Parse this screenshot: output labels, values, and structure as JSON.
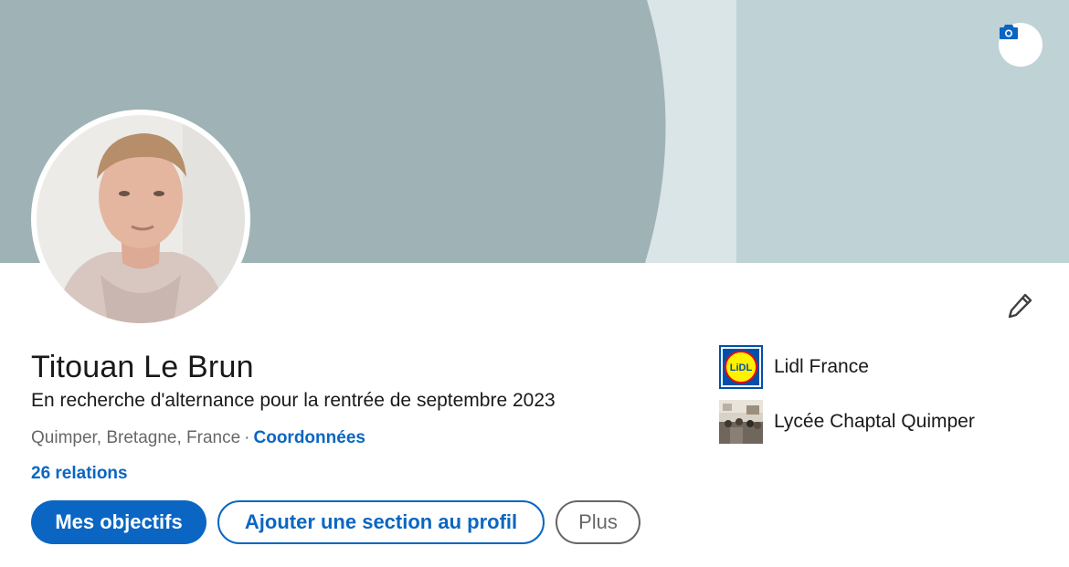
{
  "profile": {
    "name": "Titouan Le Brun",
    "headline": "En recherche d'alternance pour la rentrée de septembre 2023",
    "location": "Quimper, Bretagne, France",
    "separator": "·",
    "contact_link": "Coordonnées",
    "connections": "26 relations"
  },
  "actions": {
    "primary": "Mes objectifs",
    "add_section": "Ajouter une section au profil",
    "more": "Plus"
  },
  "experience_summary": [
    {
      "label": "Lidl France",
      "logo_text": "LiDL",
      "icon": "lidl-logo"
    },
    {
      "label": "Lycée Chaptal Quimper",
      "icon": "school-photo"
    }
  ],
  "colors": {
    "accent": "#0a66c2",
    "cover_dark": "#9fb3b6",
    "cover_light": "#bfd3d7",
    "cover_stripe": "#d9e5e7"
  },
  "icons": {
    "cover_camera": "camera-icon",
    "edit": "pencil-icon"
  }
}
